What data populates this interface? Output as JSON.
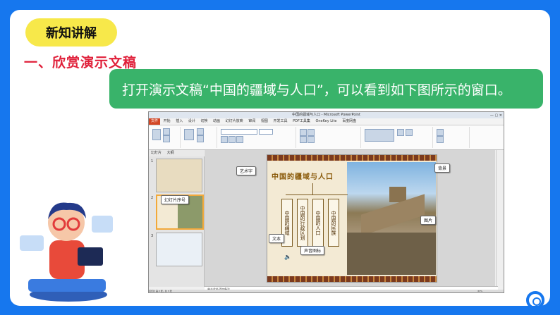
{
  "slide": {
    "badge": "新知讲解",
    "heading": "一、欣赏演示文稿",
    "banner": "打开演示文稿“中国的疆域与人口”，可以看到如下图所示的窗口。"
  },
  "ppt": {
    "window_title": "中国的疆域与人口 - Microsoft PowerPoint",
    "tabs": [
      "文件",
      "开始",
      "插入",
      "设计",
      "切换",
      "动画",
      "幻灯片放映",
      "审阅",
      "视图",
      "开发工具",
      "PDF工具集",
      "OneKey Lite",
      "百度网盘"
    ],
    "panel_tabs": [
      "幻灯片",
      "大纲"
    ],
    "thumb_numbers": [
      "1",
      "2",
      "3"
    ],
    "slide_title": "中国的疆域与人口",
    "columns": [
      "中国的疆域",
      "中国的行政区划",
      "中国的人口",
      "中国的民族"
    ],
    "notes_placeholder": "单击此处添加备注",
    "status": "幻灯片 第 2 张，共 3 张",
    "zoom": "63%"
  },
  "callouts": {
    "art_text": "艺术字",
    "background": "背景",
    "thumb_number": "幻灯片序号",
    "picture": "图片",
    "text": "文本",
    "sound_icon": "声音图标"
  },
  "colors": {
    "frame_blue": "#1677ee",
    "badge_yellow": "#f7e84a",
    "heading_red": "#e0203a",
    "banner_green": "#39b36a"
  }
}
